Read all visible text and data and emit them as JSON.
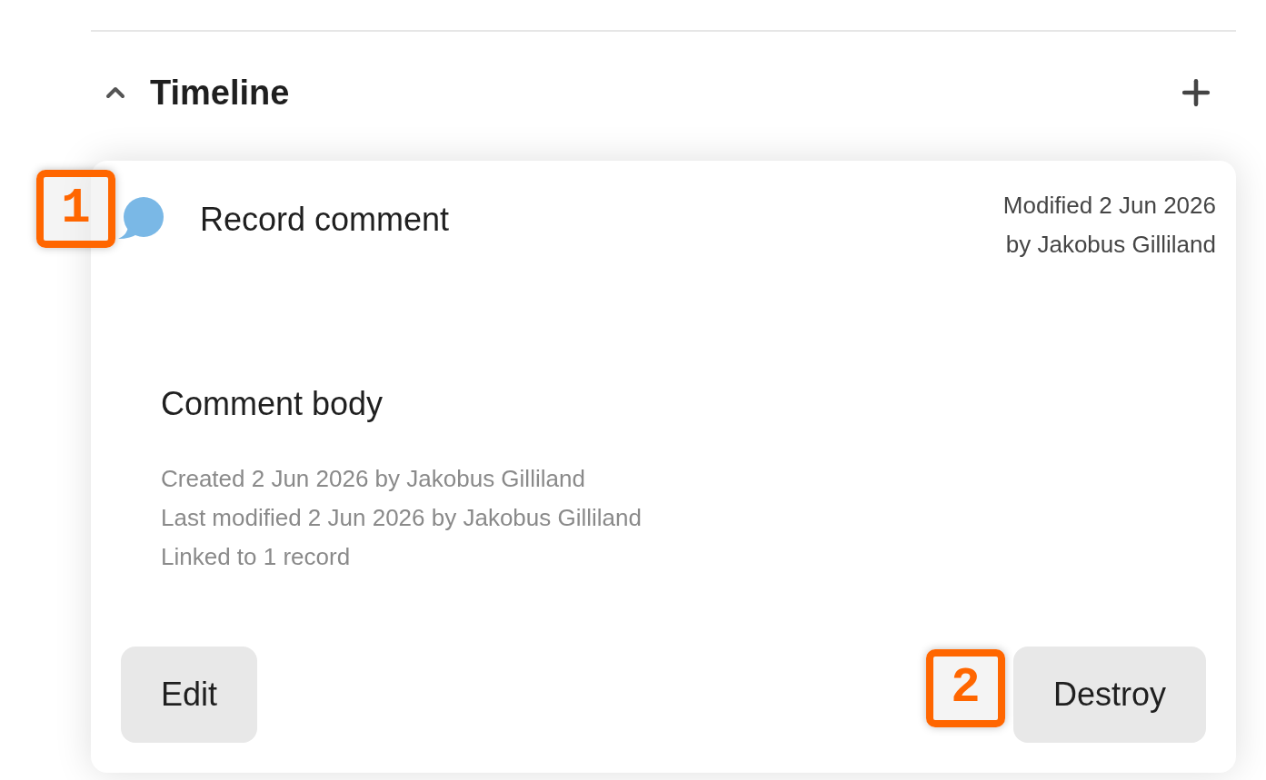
{
  "section": {
    "title": "Timeline",
    "expanded": true
  },
  "entries": [
    {
      "kind": "comment",
      "title": "Record comment",
      "modified": [
        "Modified 2 Jun 2026",
        "by Jakobus Gilliland"
      ],
      "body": "Comment body",
      "meta": [
        "Created 2 Jun 2026 by Jakobus Gilliland",
        "Last modified 2 Jun 2026 by Jakobus Gilliland",
        "Linked to 1 record"
      ],
      "actions": [
        "Edit",
        "Destroy"
      ]
    }
  ],
  "annotations": [
    {
      "label": "1"
    },
    {
      "label": "2"
    }
  ]
}
